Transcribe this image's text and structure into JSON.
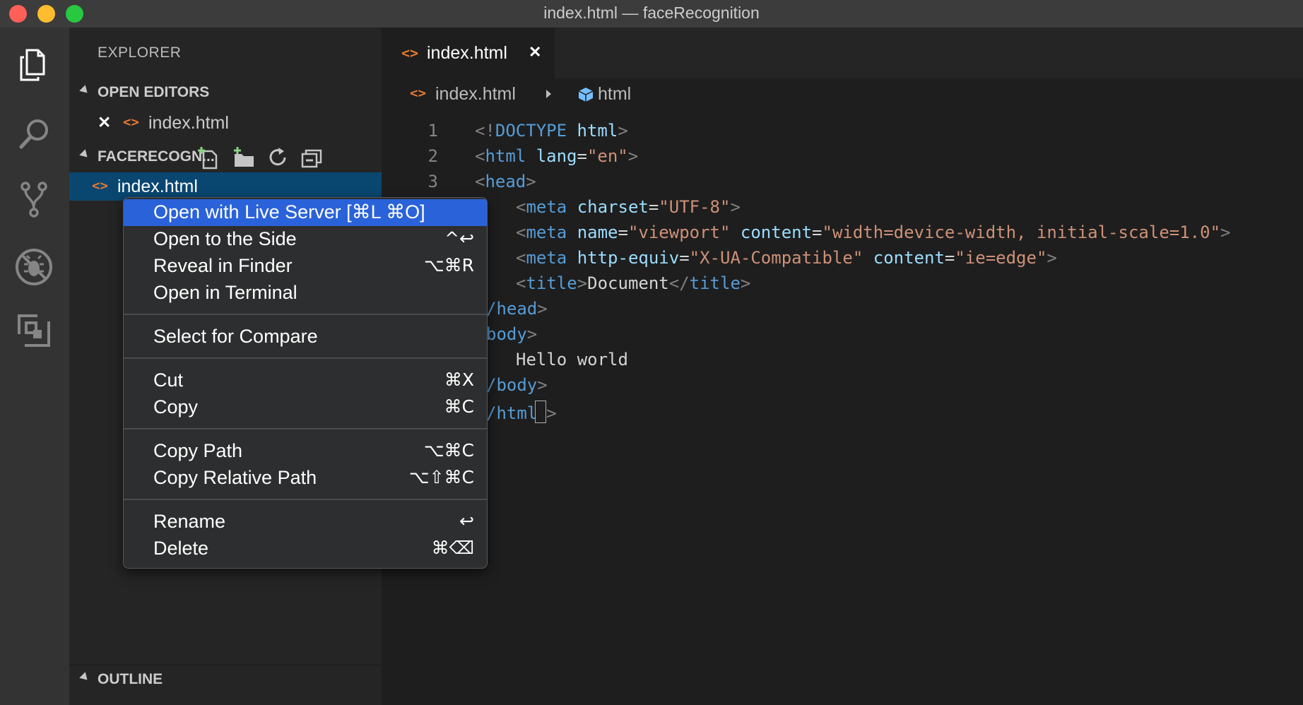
{
  "window": {
    "title": "index.html — faceRecognition",
    "traffic_lights": [
      "close",
      "minimize",
      "zoom"
    ]
  },
  "activity_bar": {
    "items": [
      {
        "icon": "files-icon",
        "active": true
      },
      {
        "icon": "search-icon",
        "active": false
      },
      {
        "icon": "source-control-icon",
        "active": false
      },
      {
        "icon": "debug-icon",
        "active": false
      },
      {
        "icon": "extensions-icon",
        "active": false
      }
    ]
  },
  "sidebar": {
    "title": "EXPLORER",
    "open_editors": {
      "label": "OPEN EDITORS",
      "items": [
        {
          "close": "✕",
          "name": "index.html"
        }
      ]
    },
    "folder": {
      "label": "FACERECOGN...",
      "tools": [
        "new-file-icon",
        "new-folder-icon",
        "refresh-icon",
        "collapse-all-icon"
      ],
      "files": [
        {
          "name": "index.html",
          "selected": true
        }
      ]
    },
    "outline": {
      "label": "OUTLINE"
    }
  },
  "editor": {
    "tab": {
      "label": "index.html",
      "close": "✕"
    },
    "breadcrumb": {
      "file": "index.html",
      "symbol": "html"
    },
    "line_numbers": [
      "1",
      "2",
      "3"
    ],
    "code": {
      "l1_open": "<!",
      "l1_doctype": "DOCTYPE",
      "l1_html": " html",
      "l1_close": ">",
      "l2_open": "<",
      "l2_tag": "html",
      "l2_attr": " lang",
      "l2_eq": "=",
      "l2_val": "\"en\"",
      "l2_close": ">",
      "l3_open": "<",
      "l3_tag": "head",
      "l3_close": ">",
      "l4_open": "<",
      "l4_tag": "meta",
      "l4_attr": " charset",
      "l4_eq": "=",
      "l4_val": "\"UTF-8\"",
      "l4_close": ">",
      "l5_open": "<",
      "l5_tag": "meta",
      "l5_attr1": " name",
      "l5_eq1": "=",
      "l5_val1": "\"viewport\"",
      "l5_attr2": " content",
      "l5_eq2": "=",
      "l5_val2": "\"width=device-width, initial-scale=1.0\"",
      "l5_close": ">",
      "l6_open": "<",
      "l6_tag": "meta",
      "l6_attr1": " http-equiv",
      "l6_eq1": "=",
      "l6_val1": "\"X-UA-Compatible\"",
      "l6_attr2": " content",
      "l6_eq2": "=",
      "l6_val2": "\"ie=edge\"",
      "l6_close": ">",
      "l7_open": "<",
      "l7_tag": "title",
      "l7_close": ">",
      "l7_text": "Document",
      "l7_open2": "</",
      "l7_tag2": "title",
      "l7_close2": ">",
      "l8_tag": "/head",
      "l8_close": ">",
      "l9_tag": "body",
      "l9_close": ">",
      "l10_text": "Hello world",
      "l11_tag": "/body",
      "l11_close": ">",
      "l12_tag": "/html",
      "l12_close": ">"
    }
  },
  "context_menu": {
    "groups": [
      [
        {
          "label": "Open with Live Server [⌘L ⌘O]",
          "shortcut": "",
          "highlighted": true
        },
        {
          "label": "Open to the Side",
          "shortcut": "^↩"
        },
        {
          "label": "Reveal in Finder",
          "shortcut": "⌥⌘R"
        },
        {
          "label": "Open in Terminal",
          "shortcut": ""
        }
      ],
      [
        {
          "label": "Select for Compare",
          "shortcut": ""
        }
      ],
      [
        {
          "label": "Cut",
          "shortcut": "⌘X"
        },
        {
          "label": "Copy",
          "shortcut": "⌘C"
        }
      ],
      [
        {
          "label": "Copy Path",
          "shortcut": "⌥⌘C"
        },
        {
          "label": "Copy Relative Path",
          "shortcut": "⌥⇧⌘C"
        }
      ],
      [
        {
          "label": "Rename",
          "shortcut": "↩"
        },
        {
          "label": "Delete",
          "shortcut": "⌘⌫"
        }
      ]
    ]
  },
  "colors": {
    "accent": "#2a62d9",
    "selection": "#094771",
    "html_icon": "#e37933",
    "tag": "#569cd6",
    "attr": "#9cdcfe",
    "string": "#ce9178"
  }
}
